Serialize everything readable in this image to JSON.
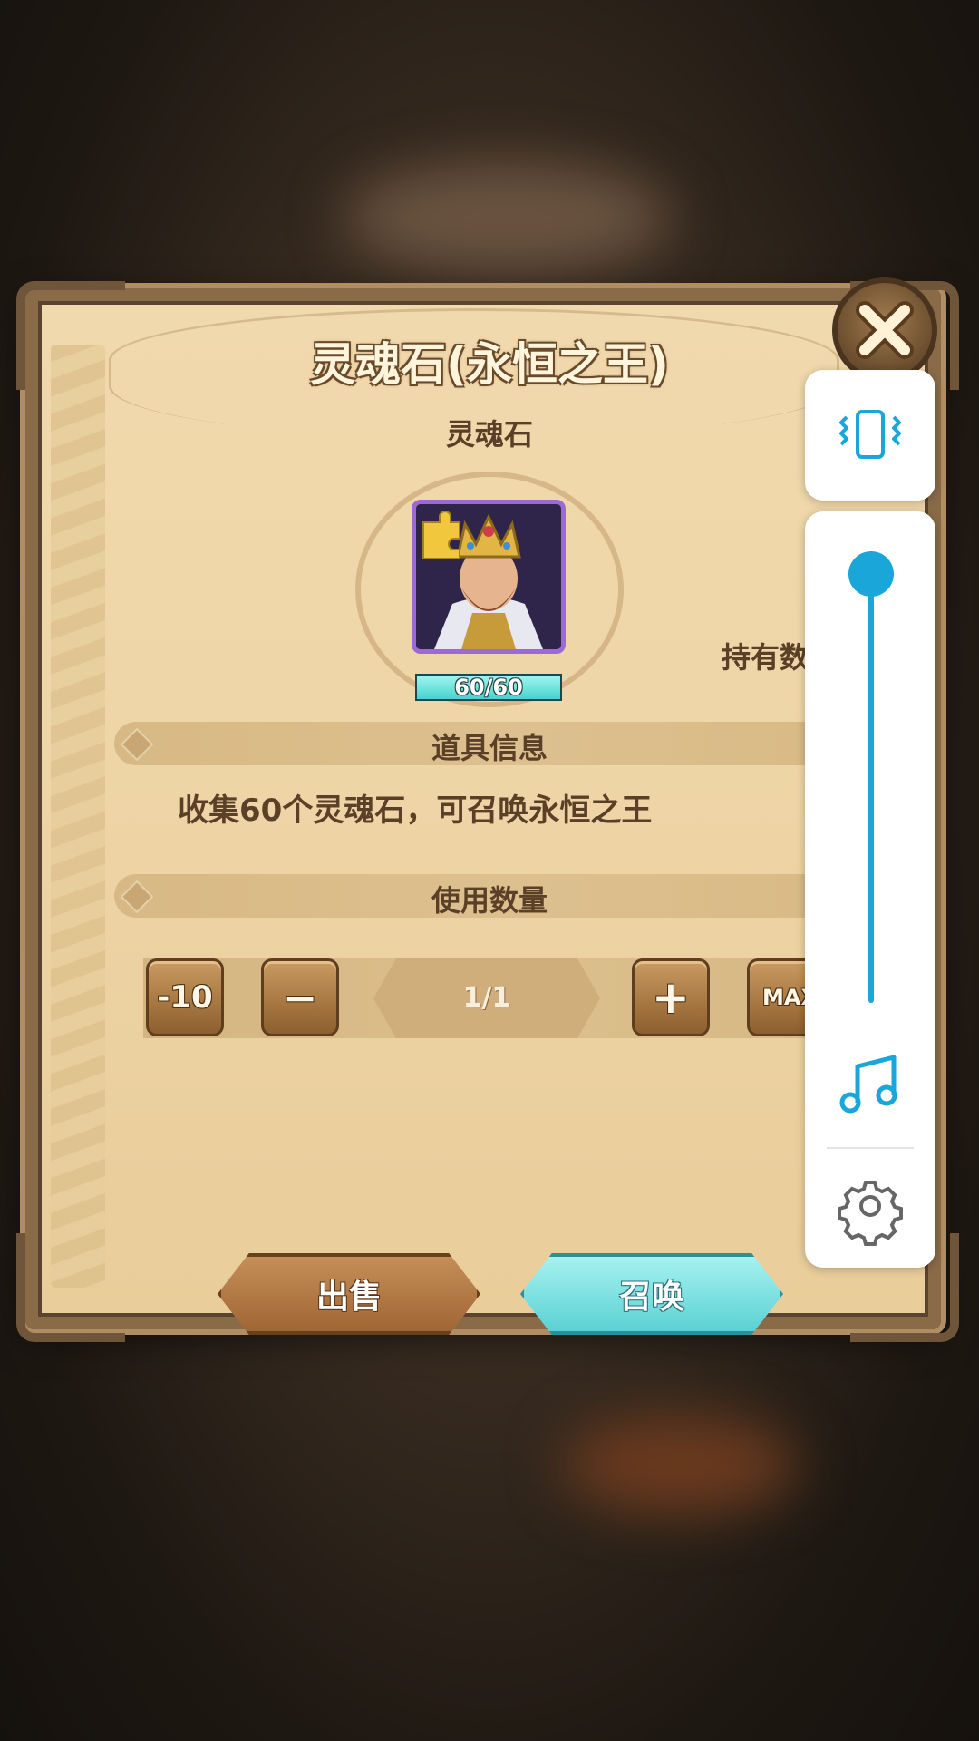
{
  "dialog": {
    "title": "灵魂石(永恒之王)",
    "subtitle": "灵魂石",
    "item": {
      "icon": "king-soulstone-icon",
      "progress_text": "60/60",
      "progress_fraction": 1.0
    },
    "owned_label": "持有数",
    "info_section": {
      "label": "道具信息",
      "description": "收集60个灵魂石，可召唤永恒之王"
    },
    "quantity_section": {
      "label": "使用数量",
      "minus10_label": "-10",
      "minus_label": "−",
      "value": "1/1",
      "plus_label": "+",
      "max_label": "MAX"
    },
    "sell_label": "出售",
    "summon_label": "召唤",
    "close_icon": "close-icon"
  },
  "overlay": {
    "vibrate_icon": "vibrate-icon",
    "volume_level": 1.0,
    "music_icon": "music-note-icon",
    "settings_icon": "gear-icon",
    "accent_color": "#1aa6d8"
  }
}
